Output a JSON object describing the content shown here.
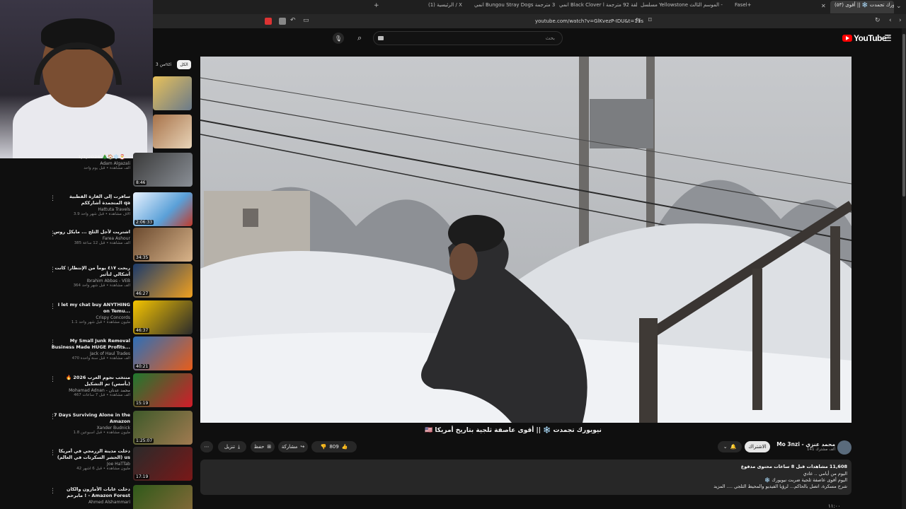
{
  "browser": {
    "tabs": [
      {
        "label": "(٥٣) نيويورك تجمدت ❄️ || أقوى ...",
        "active": true
      },
      {
        "label": "Fasel+",
        "active": false
      },
      {
        "label": "مسلسل Yellowstone الموسم الثالث -",
        "active": false
      },
      {
        "label": "انمي Black Clover الحلقة 92 مترجمة ا",
        "active": false
      },
      {
        "label": "انمي Bungou Stray Dogs الحلقة 3 مترجمة",
        "active": false
      },
      {
        "label": "(1) الرئيسية / X",
        "active": false
      }
    ],
    "url": "youtube.com/watch?v=GlKvezP-IDU&t=11s"
  },
  "header": {
    "logo_text": "YouTube",
    "logo_suffix": "SA",
    "search_placeholder": "بحث",
    "chips": [
      "من 3nzi",
      "الكل"
    ]
  },
  "video": {
    "title": "نيويورك تجمدت ❄️ || أقوى عاصفة ثلجية بتاريخ أمريكا 🇺🇸",
    "channel_handle": "Mo 3nzi - محمد عنزي",
    "subscribers": "141 ألف مشترك",
    "subscribe_label": "الاشتراك",
    "likes": "809",
    "share_label": "مشاركة",
    "save_label": "حفظ",
    "download_label": "تنزيل",
    "views_line": "11,608 مشاهدات  قبل 8 ساعات  محتوى مدفوع",
    "desc_line1": "اليوم من أيامي .. عادي",
    "desc_line2": "اليوم أقوى عاصفة ثلجية ضربت نيويورك ❄️",
    "desc_line3": "شرح مسكرة، اتصل بالحاكم... لرؤيا الفيديو والمحيط الثلجي .... المزيد",
    "time_hint": "١١:٠٠"
  },
  "sidebar": {
    "items": [
      {
        "title": "1/1/2026 🎄🏠❄️🎅...",
        "channel": "Adam Algazali",
        "meta": "ألف مشاهدة • قبل يوم واحد",
        "duration": "8:46",
        "color1": "#3a3a3a",
        "color2": "#8a8f96"
      },
      {
        "title": "سافرت إلى القارة القطبية المتجمدة أشارككم qa",
        "channel": "Hattuta Travels",
        "meta": "3.9 آلاف مشاهدة • قبل شهر واحد",
        "duration": "2:06:33",
        "color1": "#e8f2ff",
        "color2": "#c23a2a"
      },
      {
        "title": "اشتريت لأجل الثلج ... مايكل روس",
        "channel": "Farea Ashour",
        "meta": "385 ألف مشاهدة • قبل 12 ساعة",
        "duration": "34:35",
        "color1": "#6b4a2f",
        "color2": "#d9b48a"
      },
      {
        "title": "ربحت ٤١٧ يوماً من الإنتظار: كانت أشكالي لتأثير",
        "channel": "Ibrahim Abbas - VEB",
        "meta": "364 ألف مشاهدة • قبل شهر واحد",
        "duration": "46:27",
        "color1": "#1b3a6b",
        "color2": "#f0a020"
      },
      {
        "title": "I let my chat buy ANYTHING on Temu...",
        "channel": "Crispy Concords",
        "meta": "1.1 مليون مشاهدة • قبل شهر واحد",
        "duration": "46:37",
        "color1": "#f5c400",
        "color2": "#2b2b2b"
      },
      {
        "title": "My Small Junk Removal Business Made HUGE Profits...",
        "channel": "Jack of Haul Trades",
        "meta": "470 ألف مشاهدة • قبل سنة واحدة",
        "duration": "40:21",
        "color1": "#2d6fb8",
        "color2": "#e85d1a"
      },
      {
        "title": "منتخب نجوم العرب 2026 🔥 (بأسس) تم التشكيل",
        "channel": "Mohamad Adnan - محمد عدنان",
        "meta": "467 ألف مشاهدة • قبل 7 ساعات",
        "duration": "15:19",
        "color1": "#1f7a2e",
        "color2": "#d21c2a"
      },
      {
        "title": "7 Days Surviving Alone in the Amazon",
        "channel": "Xander Budnick",
        "meta": "1.8 مليون مشاهدة • قبل أسبوعين",
        "duration": "1:25:07",
        "color1": "#3e5a2a",
        "color2": "#a07a50"
      },
      {
        "title": "دخلت مدينة الزرمجي في أمريكا (الحشر السكرتات في العالم) us",
        "channel": "Joe HaTTab",
        "meta": "42 مليون مشاهدة • قبل 6 أشهر",
        "duration": "17:19",
        "color1": "#2a2a2a",
        "color2": "#7a1818"
      },
      {
        "title": "دخلت غابات الأمازون والكان مابرحم ! - Amazon Forest",
        "channel": "Ahmed Alshammari",
        "meta": "",
        "duration": "",
        "color1": "#2f5a1a",
        "color2": "#8a6a3a"
      }
    ]
  }
}
